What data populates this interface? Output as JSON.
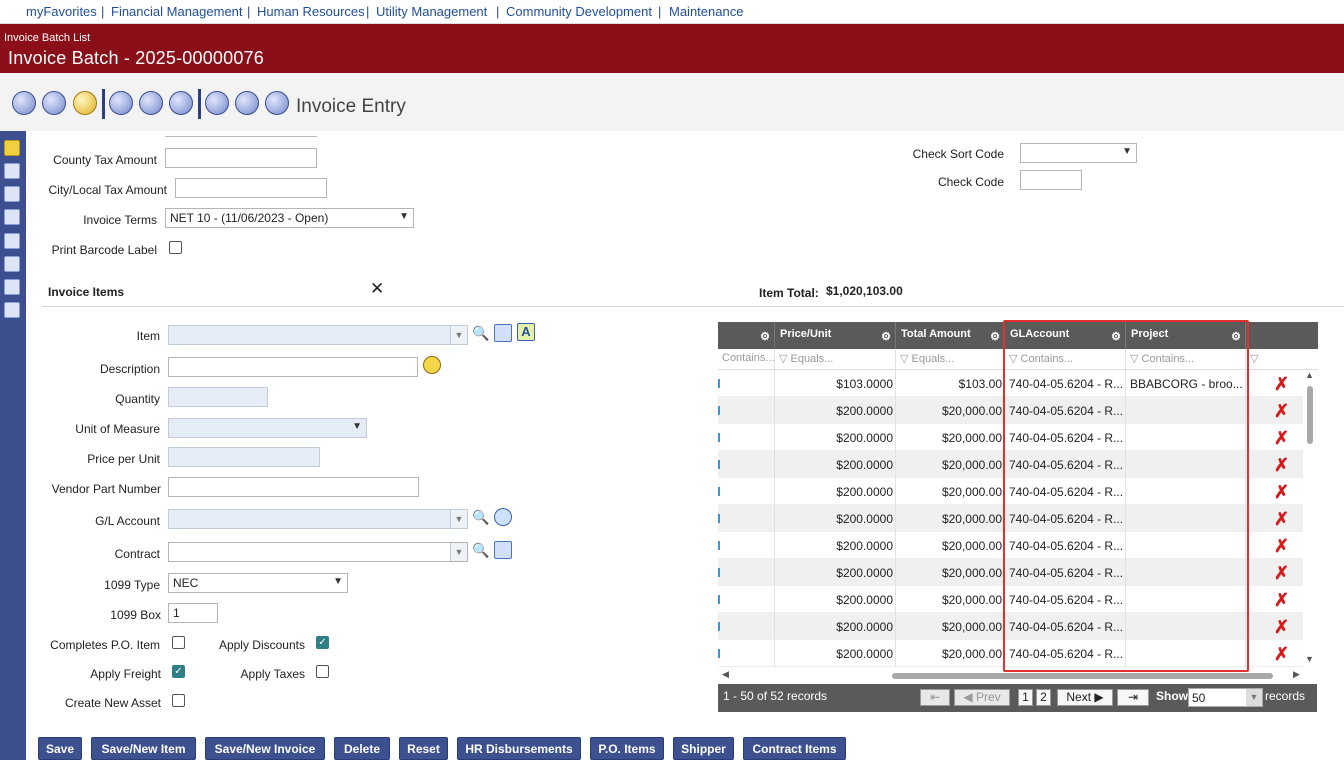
{
  "topnav": {
    "links": [
      "myFavorites",
      "Financial Management",
      "Human Resources",
      "Utility Management",
      "Community Development",
      "Maintenance"
    ],
    "separator": "|"
  },
  "header": {
    "breadcrumb": "Invoice Batch List",
    "title": "Invoice Batch - 2025-00000076"
  },
  "toolbar": {
    "title": "Invoice Entry",
    "icons": [
      "info-icon",
      "list-icon",
      "edit-icon",
      "forward-icon",
      "refresh-icon",
      "dollar-icon",
      "approve-icon",
      "drop-icon",
      "stamp-icon"
    ]
  },
  "sidebar": {
    "icons": [
      "edit-icon",
      "link-icon",
      "clock-icon",
      "dollar-icon",
      "stamp-icon",
      "report-icon",
      "notes-icon",
      "checklist-icon"
    ]
  },
  "form": {
    "county_tax_label": "County Tax Amount",
    "county_tax_value": "",
    "city_tax_label": "City/Local Tax Amount",
    "city_tax_value": "",
    "invoice_terms_label": "Invoice Terms",
    "invoice_terms_value": "NET 10 - (11/06/2023 - Open)",
    "print_barcode_label": "Print Barcode Label",
    "print_barcode_checked": false,
    "check_sort_code_label": "Check Sort Code",
    "check_sort_code_value": "",
    "check_code_label": "Check Code",
    "check_code_value": ""
  },
  "invoice_items": {
    "section_title": "Invoice Items",
    "item_total_label": "Item Total:",
    "item_total_value": "$1,020,103.00",
    "fields": {
      "item_label": "Item",
      "description_label": "Description",
      "quantity_label": "Quantity",
      "uom_label": "Unit of Measure",
      "price_label": "Price per Unit",
      "vendor_part_label": "Vendor Part Number",
      "gl_account_label": "G/L Account",
      "contract_label": "Contract",
      "type_1099_label": "1099 Type",
      "type_1099_value": "NEC",
      "box_1099_label": "1099 Box",
      "box_1099_value": "1",
      "completes_po_label": "Completes P.O. Item",
      "completes_po_checked": false,
      "apply_discounts_label": "Apply Discounts",
      "apply_discounts_checked": true,
      "apply_freight_label": "Apply Freight",
      "apply_freight_checked": true,
      "apply_taxes_label": "Apply Taxes",
      "apply_taxes_checked": false,
      "create_asset_label": "Create New Asset",
      "create_asset_checked": false
    }
  },
  "grid": {
    "columns": [
      "",
      "Price/Unit",
      "Total Amount",
      "GLAccount",
      "Project"
    ],
    "filters": [
      "Contains...",
      "Equals...",
      "Equals...",
      "Contains...",
      "Contains..."
    ],
    "rows": [
      {
        "price": "$103.0000",
        "total": "$103.00",
        "gl": "740-04-05.6204 - R...",
        "project": "BBABCORG - broo..."
      },
      {
        "price": "$200.0000",
        "total": "$20,000.00",
        "gl": "740-04-05.6204 - R...",
        "project": ""
      },
      {
        "price": "$200.0000",
        "total": "$20,000.00",
        "gl": "740-04-05.6204 - R...",
        "project": ""
      },
      {
        "price": "$200.0000",
        "total": "$20,000.00",
        "gl": "740-04-05.6204 - R...",
        "project": ""
      },
      {
        "price": "$200.0000",
        "total": "$20,000.00",
        "gl": "740-04-05.6204 - R...",
        "project": ""
      },
      {
        "price": "$200.0000",
        "total": "$20,000.00",
        "gl": "740-04-05.6204 - R...",
        "project": ""
      },
      {
        "price": "$200.0000",
        "total": "$20,000.00",
        "gl": "740-04-05.6204 - R...",
        "project": ""
      },
      {
        "price": "$200.0000",
        "total": "$20,000.00",
        "gl": "740-04-05.6204 - R...",
        "project": ""
      },
      {
        "price": "$200.0000",
        "total": "$20,000.00",
        "gl": "740-04-05.6204 - R...",
        "project": ""
      },
      {
        "price": "$200.0000",
        "total": "$20,000.00",
        "gl": "740-04-05.6204 - R...",
        "project": ""
      },
      {
        "price": "$200.0000",
        "total": "$20,000.00",
        "gl": "740-04-05.6204 - R...",
        "project": ""
      }
    ],
    "pager": {
      "summary": "1 - 50 of 52 records",
      "prev": "Prev",
      "pages": [
        "1",
        "2"
      ],
      "next": "Next",
      "show_label": "Show",
      "page_size": "50",
      "records_label": "records"
    }
  },
  "buttons": [
    "Save",
    "Save/New Item",
    "Save/New Invoice",
    "Delete",
    "Reset",
    "HR Disbursements",
    "P.O. Items",
    "Shipper",
    "Contract Items"
  ],
  "colors": {
    "header_bg": "#8b0f19",
    "nav_link": "#1f4e99",
    "button_bg": "#3d5191",
    "grid_header": "#5a5a5a",
    "highlight_border": "#e03131",
    "delete_icon": "#d41b1b"
  }
}
